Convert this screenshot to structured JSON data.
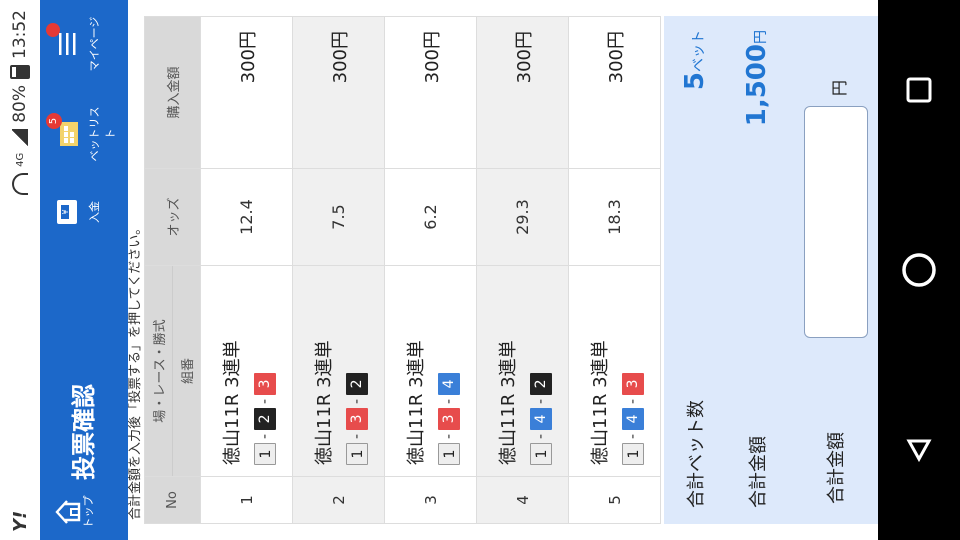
{
  "status": {
    "carrier_logo": "Y!",
    "network": "4G",
    "battery": "80%",
    "time": "13:52"
  },
  "header": {
    "home_label": "トップ",
    "title": "投票確認",
    "deposit_label": "入金",
    "betlist_label": "ベットリスト",
    "betlist_badge": "5",
    "mypage_label": "マイページ",
    "brand_color": "#1c68c9"
  },
  "notice": "合計金額を入力後「投票する」を押してください。",
  "table": {
    "headers": {
      "no": "No",
      "race": "場・レース・勝式",
      "combo": "組番",
      "odds": "オッズ",
      "amount": "購入金額"
    },
    "rows": [
      {
        "no": "1",
        "race": "徳山11R 3連単",
        "c1": "1",
        "c2": "2",
        "c3": "3",
        "odds": "12.4",
        "amount": "300円"
      },
      {
        "no": "2",
        "race": "徳山11R 3連単",
        "c1": "1",
        "c2": "3",
        "c3": "2",
        "odds": "7.5",
        "amount": "300円"
      },
      {
        "no": "3",
        "race": "徳山11R 3連単",
        "c1": "1",
        "c2": "3",
        "c3": "4",
        "odds": "6.2",
        "amount": "300円"
      },
      {
        "no": "4",
        "race": "徳山11R 3連単",
        "c1": "1",
        "c2": "4",
        "c3": "2",
        "odds": "29.3",
        "amount": "300円"
      },
      {
        "no": "5",
        "race": "徳山11R 3連単",
        "c1": "1",
        "c2": "4",
        "c3": "3",
        "odds": "18.3",
        "amount": "300円"
      }
    ]
  },
  "summary": {
    "bet_count_label": "合計ベット数",
    "bet_count_value": "5",
    "bet_count_unit": "ベット",
    "total_label": "合計金額",
    "total_value": "1,500",
    "total_unit": "円"
  },
  "input": {
    "label": "合計金額",
    "value": "",
    "unit": "円"
  }
}
